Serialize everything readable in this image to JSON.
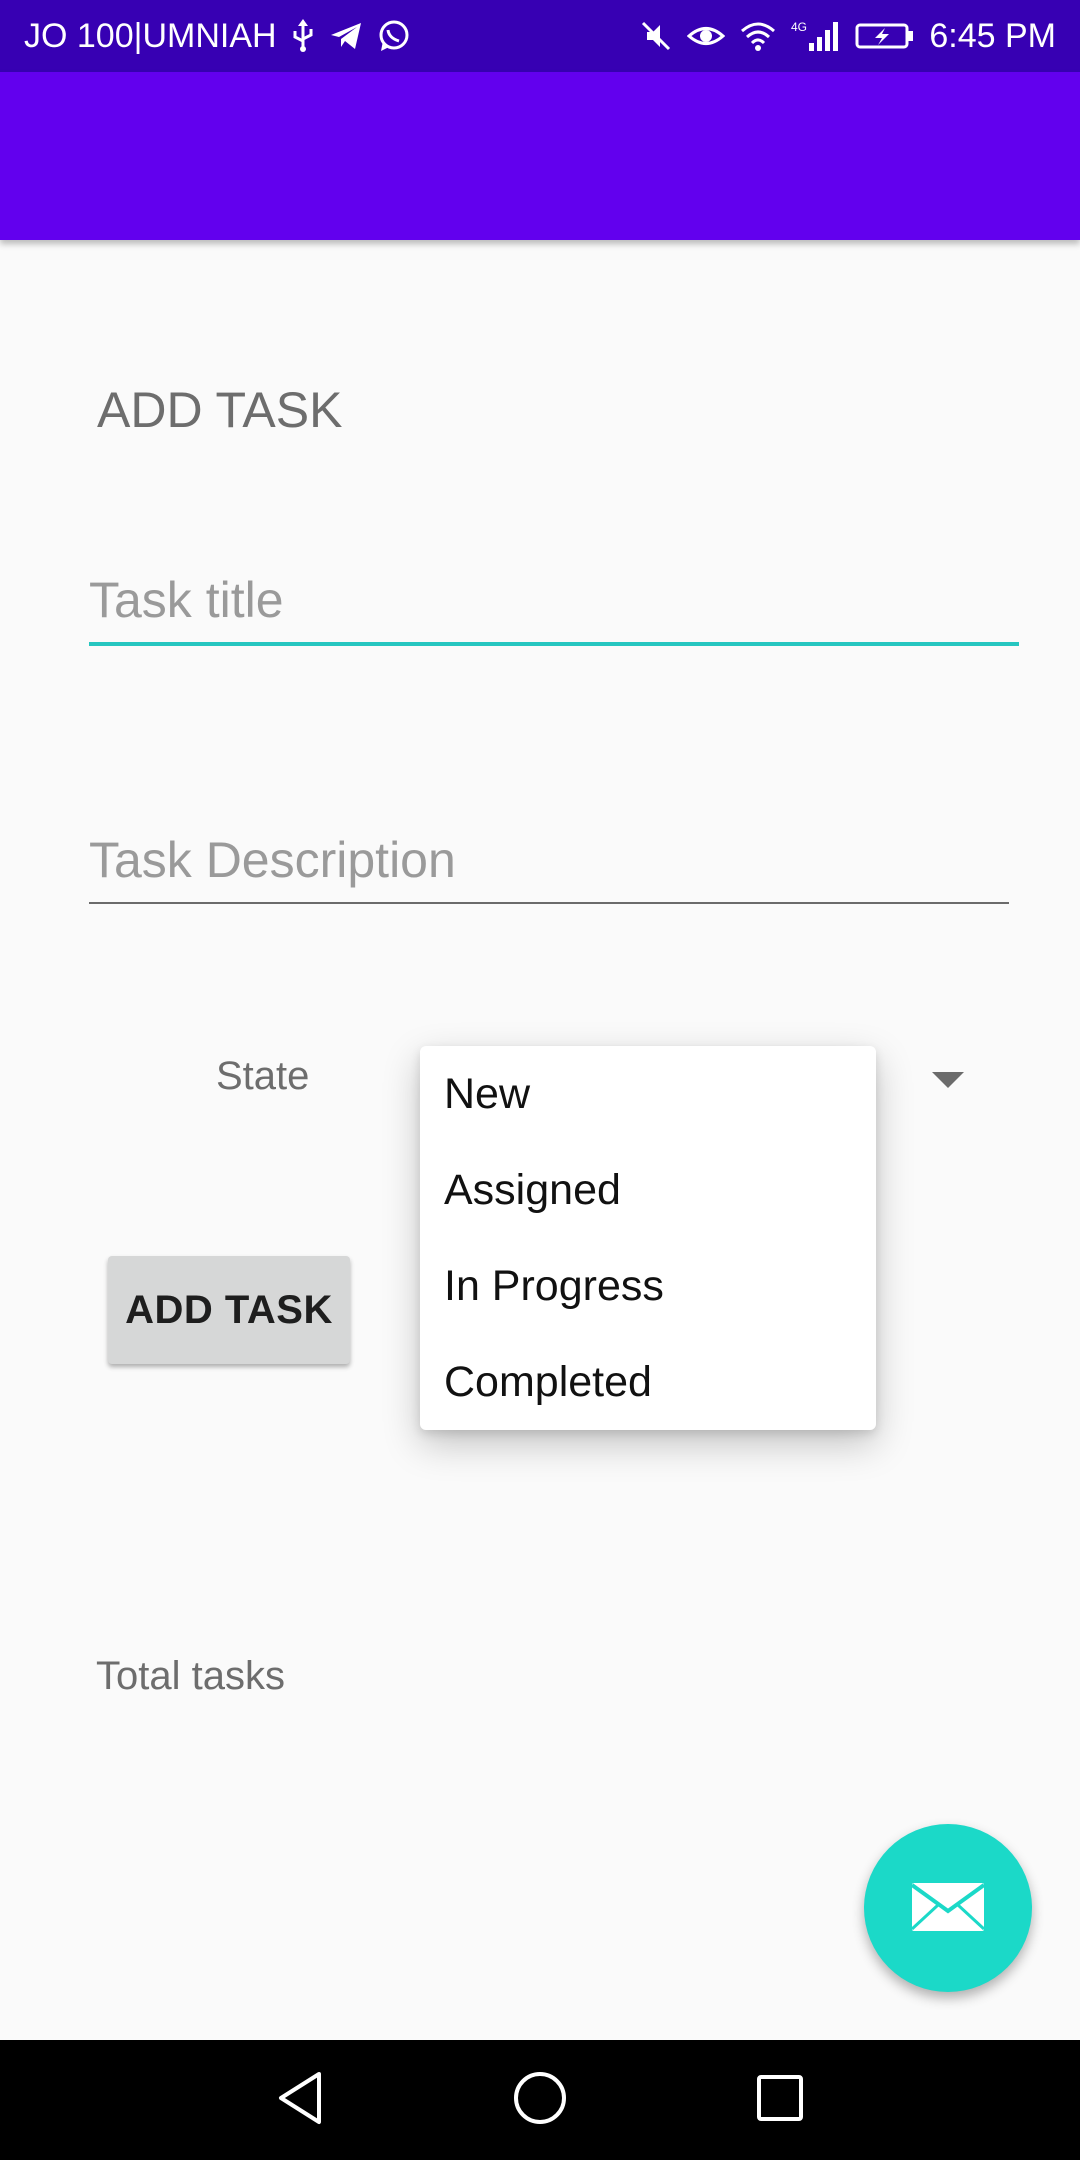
{
  "status_bar": {
    "carrier": "JO 100|UMNIAH",
    "network": "4G",
    "time": "6:45 PM",
    "icons": [
      "usb-icon",
      "telegram-icon",
      "whatsapp-icon",
      "mute-icon",
      "eye-icon",
      "wifi-icon",
      "signal-icon",
      "battery-icon"
    ]
  },
  "colors": {
    "status_bar": "#3700b3",
    "app_bar": "#6200ee",
    "accent": "#26c6c0",
    "fab": "#1bd9c8"
  },
  "form": {
    "heading": "ADD TASK",
    "title_placeholder": "Task title",
    "description_placeholder": "Task Description",
    "state_label": "State",
    "add_button_label": "ADD TASK",
    "total_label": "Total tasks"
  },
  "dropdown": {
    "options": [
      "New",
      "Assigned",
      "In Progress",
      "Completed"
    ]
  },
  "fab": {
    "icon": "email-icon"
  },
  "nav": {
    "icons": [
      "back-icon",
      "home-icon",
      "recents-icon"
    ]
  }
}
